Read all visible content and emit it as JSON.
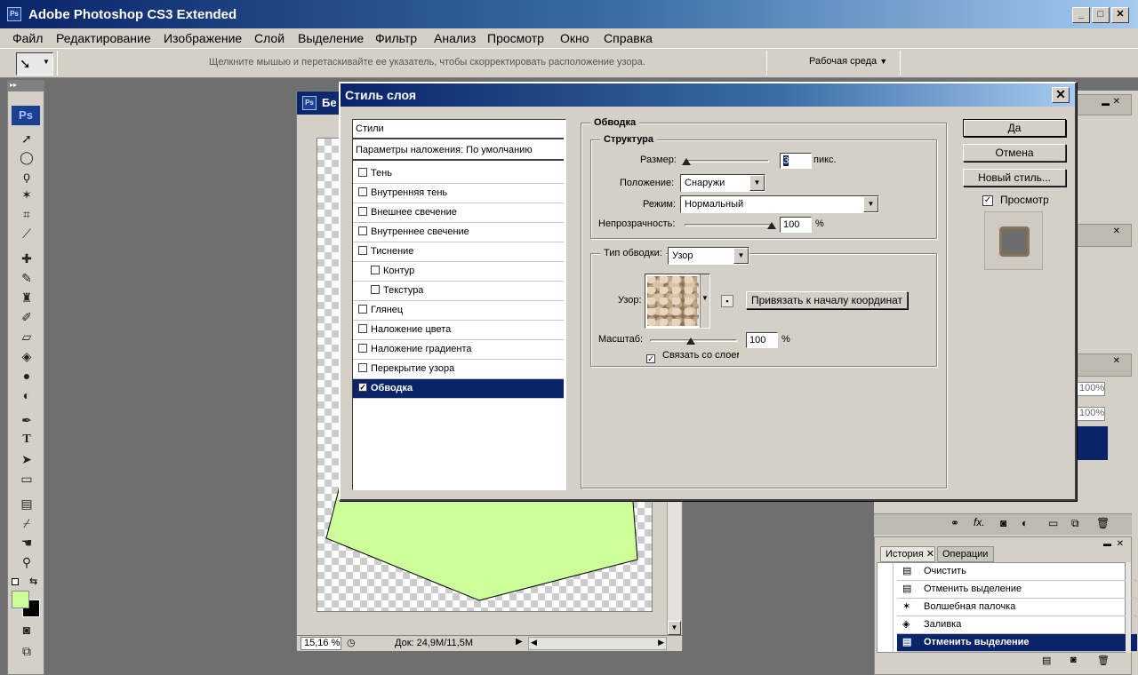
{
  "app": {
    "title": "Adobe Photoshop CS3 Extended",
    "logo": "Ps"
  },
  "menu": [
    "Файл",
    "Редактирование",
    "Изображение",
    "Слой",
    "Выделение",
    "Фильтр",
    "Анализ",
    "Просмотр",
    "Окно",
    "Справка"
  ],
  "options": {
    "hint": "Щелкните мышью и перетаскивайте ее указатель, чтобы скорректировать расположение узора.",
    "workspace": "Рабочая среда"
  },
  "doc": {
    "title_fragment": "Бе",
    "zoom": "15,16 %",
    "status": "Док: 24,9M/11,5M"
  },
  "colors": {
    "accent": "#0a246a",
    "foreground": "#ccff99",
    "shape": "#ccff99"
  },
  "dialog": {
    "title": "Стиль слоя",
    "styles_header": "Стили",
    "blend_options": "Параметры наложения: По умолчанию",
    "styles": [
      {
        "label": "Тень",
        "checked": false,
        "indent": false
      },
      {
        "label": "Внутренняя тень",
        "checked": false,
        "indent": false
      },
      {
        "label": "Внешнее свечение",
        "checked": false,
        "indent": false
      },
      {
        "label": "Внутреннее свечение",
        "checked": false,
        "indent": false
      },
      {
        "label": "Тиснение",
        "checked": false,
        "indent": false
      },
      {
        "label": "Контур",
        "checked": false,
        "indent": true
      },
      {
        "label": "Текстура",
        "checked": false,
        "indent": true
      },
      {
        "label": "Глянец",
        "checked": false,
        "indent": false
      },
      {
        "label": "Наложение цвета",
        "checked": false,
        "indent": false
      },
      {
        "label": "Наложение градиента",
        "checked": false,
        "indent": false
      },
      {
        "label": "Перекрытие узора",
        "checked": false,
        "indent": false
      },
      {
        "label": "Обводка",
        "checked": true,
        "indent": false,
        "selected": true
      }
    ],
    "stroke": {
      "section": "Обводка",
      "structure": "Структура",
      "size_label": "Размер:",
      "size_value": "3",
      "size_unit": "пикс.",
      "position_label": "Положение:",
      "position_value": "Снаружи",
      "mode_label": "Режим:",
      "mode_value": "Нормальный",
      "opacity_label": "Непрозрачность:",
      "opacity_value": "100",
      "opacity_unit": "%",
      "fill_type_label": "Тип обводки:",
      "fill_type_value": "Узор",
      "pattern_label": "Узор:",
      "snap_button": "Привязать к началу координат",
      "scale_label": "Масштаб:",
      "scale_value": "100",
      "scale_unit": "%",
      "link_label": "Связать со слоем",
      "link_checked": true
    },
    "buttons": {
      "ok": "Да",
      "cancel": "Отмена",
      "new_style": "Новый стиль..."
    },
    "preview_label": "Просмотр",
    "preview_checked": true
  },
  "panels": {
    "pct1": "100%",
    "pct2": "100%",
    "history_tab": "История",
    "actions_tab": "Операции",
    "history": [
      {
        "label": "Очистить",
        "icon": "document-icon"
      },
      {
        "label": "Отменить выделение",
        "icon": "document-icon"
      },
      {
        "label": "Волшебная палочка",
        "icon": "magic-wand-icon"
      },
      {
        "label": "Заливка",
        "icon": "paint-bucket-icon"
      },
      {
        "label": "Отменить выделение",
        "icon": "document-icon",
        "selected": true
      }
    ]
  }
}
